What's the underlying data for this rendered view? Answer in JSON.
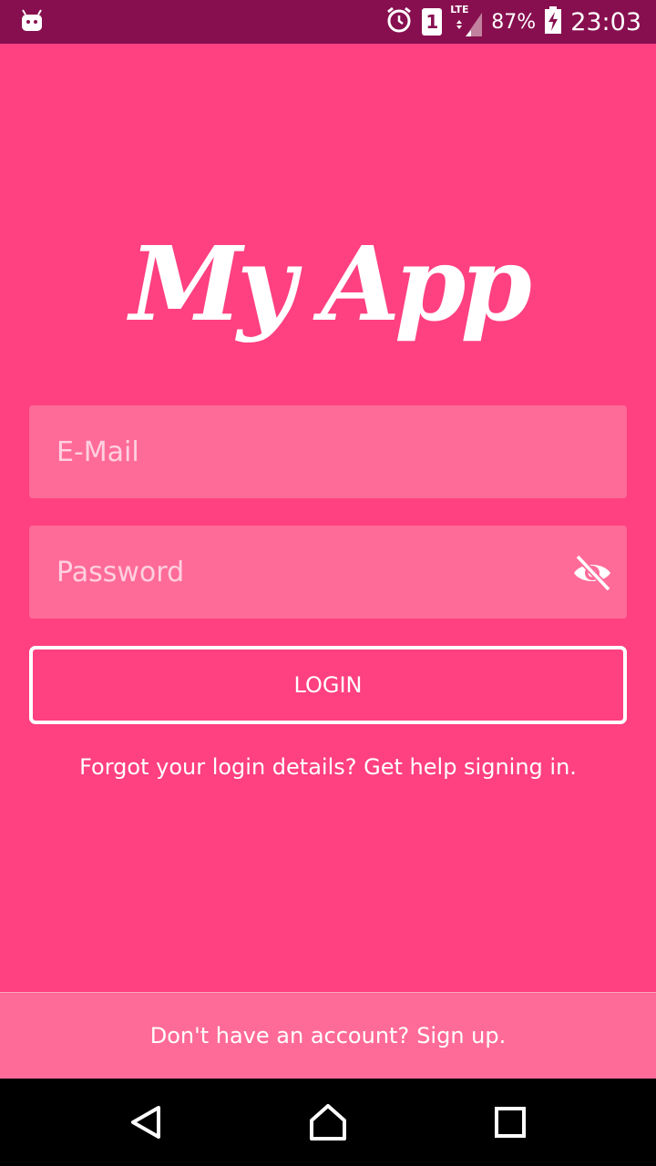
{
  "status_bar": {
    "sim_slot": "1",
    "network_type": "LTE",
    "battery": "87%",
    "time": "23:03",
    "icons": [
      "android-notification-icon",
      "alarm-icon",
      "sim-icon",
      "signal-icon",
      "battery-charging-icon"
    ]
  },
  "logo": {
    "text": "My App"
  },
  "form": {
    "email_placeholder": "E-Mail",
    "password_placeholder": "Password",
    "password_toggle_icon": "eye-off-icon",
    "login_label": "LOGIN"
  },
  "help": {
    "prefix": "Forgot your login details?",
    "link": "Get help signing in."
  },
  "signup": {
    "prefix": "Don't have an account?",
    "link": "Sign up."
  },
  "nav": {
    "icons": [
      "back-icon",
      "home-icon",
      "recents-icon"
    ]
  },
  "colors": {
    "primary": "#ff4081",
    "field_bg": "#ff6b99",
    "status_bar": "#870f4f",
    "text": "#ffffff"
  }
}
